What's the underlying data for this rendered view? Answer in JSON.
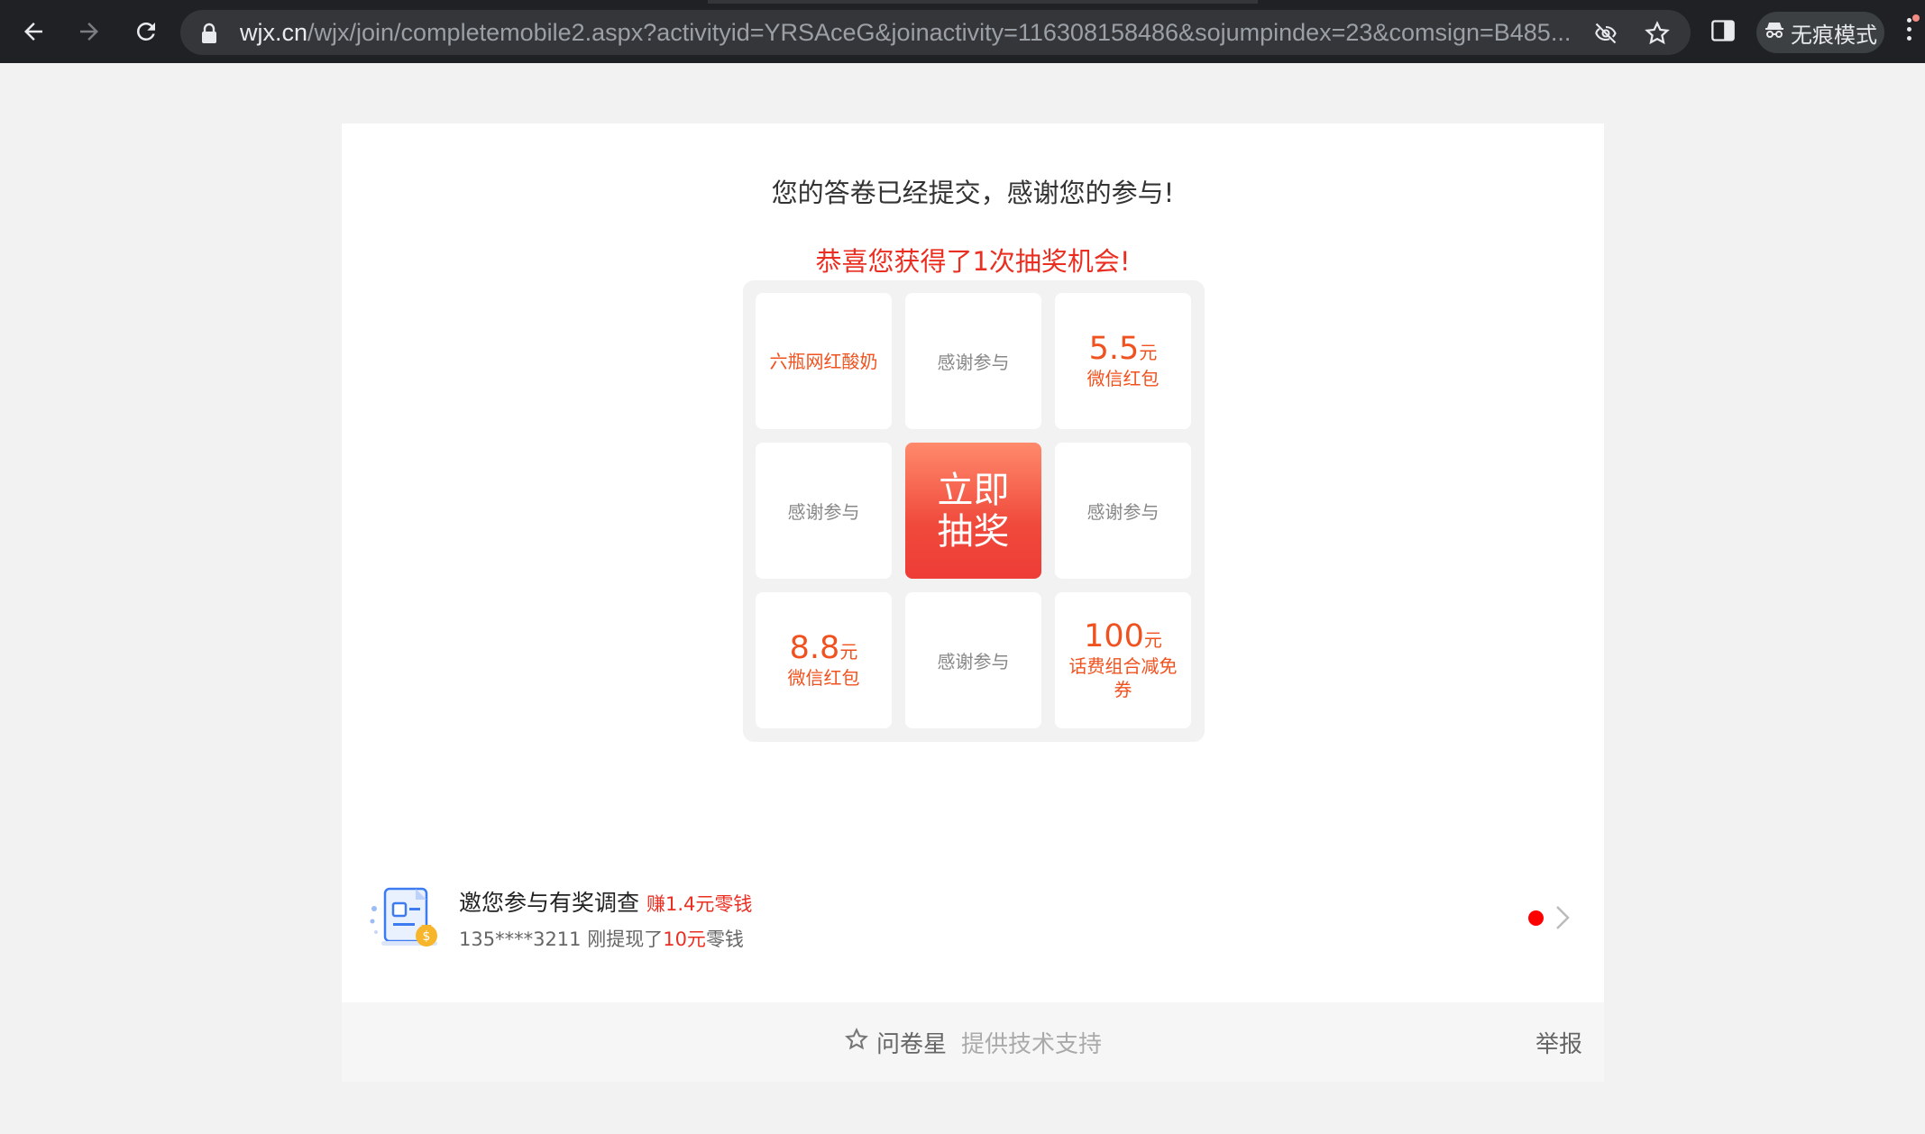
{
  "browser": {
    "url_host": "wjx.cn",
    "url_path": "/wjx/join/completemobile2.aspx?activityid=YRSAceG&joinactivity=116308158486&sojumpindex=23&comsign=B485...",
    "incognito_label": "无痕模式"
  },
  "page": {
    "thanks": "您的答卷已经提交，感谢您的参与!",
    "congrats": "恭喜您获得了1次抽奖机会!"
  },
  "lottery": {
    "cells": {
      "c1": "六瓶网红酸奶",
      "c2": "感谢参与",
      "c3_amount": "5.5",
      "c3_unit": "元",
      "c3_label": "微信红包",
      "c4": "感谢参与",
      "go_label": "立即抽奖",
      "c6": "感谢参与",
      "c7_amount": "8.8",
      "c7_unit": "元",
      "c7_label": "微信红包",
      "c8": "感谢参与",
      "c9_amount": "100",
      "c9_unit": "元",
      "c9_label": "话费组合减免券"
    }
  },
  "promo": {
    "title": "邀您参与有奖调查",
    "earn": "赚1.4元零钱",
    "sub_prefix": "135****3211 刚提现了",
    "sub_amount": "10元",
    "sub_suffix": "零钱"
  },
  "footer": {
    "brand": "问卷星",
    "brand_sub": "提供技术支持",
    "report": "举报"
  },
  "colors": {
    "accent_red": "#ea2f22",
    "prize_orange": "#f0521f",
    "button_gradient_top": "#ff8a6b",
    "button_gradient_bottom": "#ee3c36"
  },
  "icons": [
    "back-arrow-icon",
    "forward-arrow-icon",
    "reload-icon",
    "lock-icon",
    "eye-off-icon",
    "star-icon",
    "side-panel-icon",
    "incognito-icon",
    "more-menu-icon",
    "survey-document-icon",
    "chevron-right-icon",
    "star-outline-icon"
  ]
}
